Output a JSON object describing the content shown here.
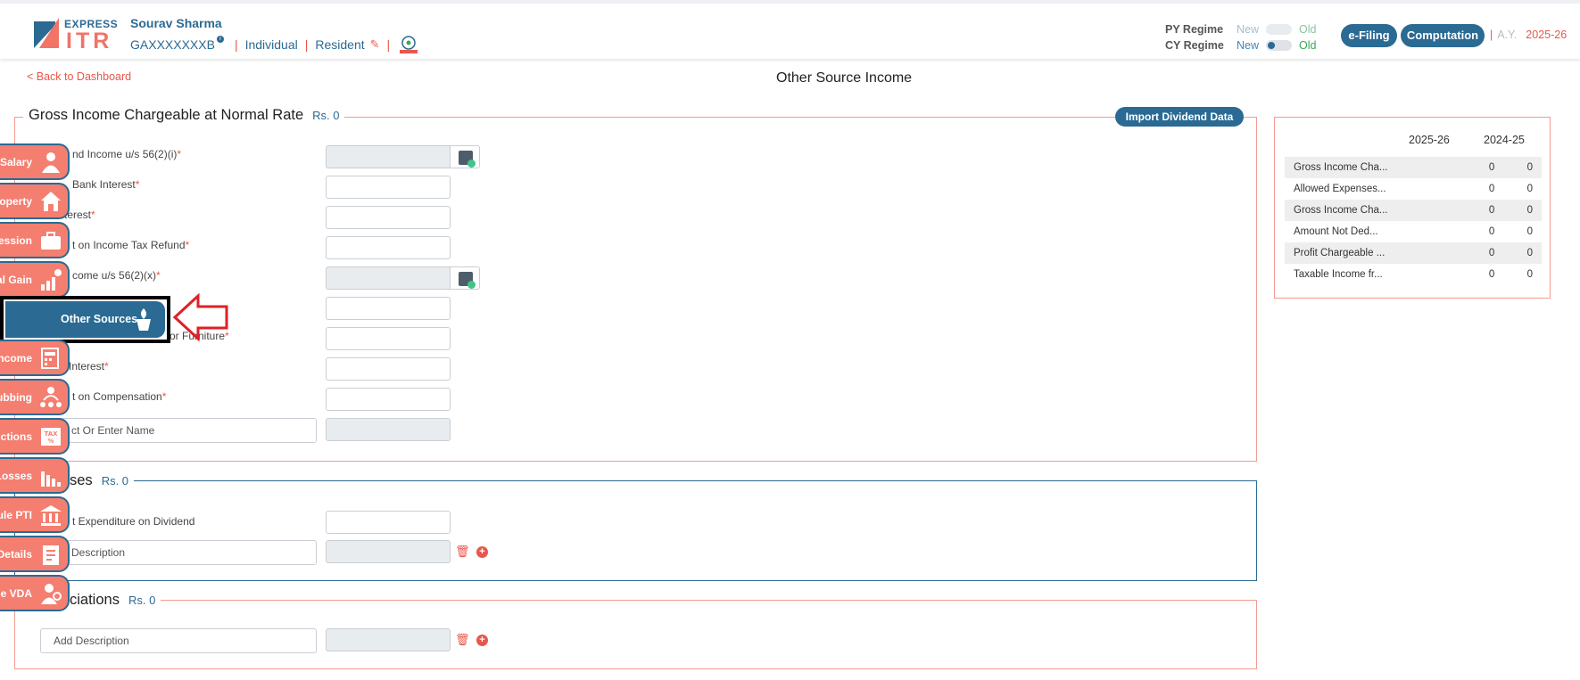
{
  "header": {
    "logo_top": "EXPRESS",
    "logo_bottom": "ITR",
    "user_name": "Sourav Sharma",
    "pan": "GAXXXXXXXB",
    "status": "Individual",
    "residency": "Resident",
    "regime": {
      "py_label": "PY Regime",
      "cy_label": "CY Regime",
      "new_label": "New",
      "old_label": "Old"
    },
    "efiling_label": "e-Filing",
    "computation_label": "Computation",
    "ay_label": "A.Y.",
    "ay_value": "2025-26"
  },
  "page": {
    "back_label": "< Back to Dashboard",
    "title": "Other Source Income"
  },
  "gross_section": {
    "title": "Gross Income Chargeable at Normal Rate",
    "amount": "Rs.  0",
    "import_label": "Import Dividend Data",
    "fields": [
      {
        "label": "nd Income u/s 56(2)(i)",
        "required": "*"
      },
      {
        "label": "Bank Interest",
        "required": "*"
      },
      {
        "label": "terest",
        "required": "*"
      },
      {
        "label": "t on Income Tax Refund",
        "required": "*"
      },
      {
        "label": "come u/s 56(2)(x)",
        "required": "*"
      },
      {
        "label": "",
        "required": ""
      },
      {
        "label": "or Furniture",
        "required": "*"
      },
      {
        "label": "Interest",
        "required": "*"
      },
      {
        "label": "t on Compensation",
        "required": "*"
      }
    ],
    "select_placeholder": "ct Or Enter Name"
  },
  "expenses_section": {
    "title": "ses",
    "amount": "Rs.  0",
    "field_label": "t Expenditure on Dividend",
    "desc_placeholder": "Description"
  },
  "deductions_section": {
    "title": "ciations",
    "amount": "Rs.  0",
    "desc_placeholder": "Add Description"
  },
  "summary": {
    "col1": "2025-26",
    "col2": "2024-25",
    "rows": [
      {
        "label": "Gross Income Cha...",
        "v1": "0",
        "v2": "0"
      },
      {
        "label": "Allowed Expenses...",
        "v1": "0",
        "v2": "0"
      },
      {
        "label": "Gross Income Cha...",
        "v1": "0",
        "v2": "0"
      },
      {
        "label": "Amount Not Ded...",
        "v1": "0",
        "v2": "0"
      },
      {
        "label": "Profit Chargeable ...",
        "v1": "0",
        "v2": "0"
      },
      {
        "label": "Taxable Income fr...",
        "v1": "0",
        "v2": "0"
      }
    ]
  },
  "sidebar": {
    "items": [
      {
        "label": "Salary",
        "icon": "person-icon"
      },
      {
        "label": "operty",
        "icon": "house-icon"
      },
      {
        "label": "fession",
        "icon": "briefcase-icon"
      },
      {
        "label": "al Gain",
        "icon": "growth-chart-icon"
      },
      {
        "label": "Other Sources",
        "icon": "plant-pot-icon"
      },
      {
        "label": "ncome",
        "icon": "tax-calculator-icon"
      },
      {
        "label": "ubbing",
        "icon": "family-tree-icon"
      },
      {
        "label": "uctions",
        "icon": "tax-percent-icon"
      },
      {
        "label": "Losses",
        "icon": "declining-chart-icon"
      },
      {
        "label": "ule PTI",
        "icon": "bank-icon"
      },
      {
        "label": "Details",
        "icon": "tax-clipboard-icon"
      },
      {
        "label": "ule VDA",
        "icon": "person-coin-icon"
      }
    ]
  },
  "colors": {
    "brand_blue": "#2b6a93",
    "accent_red": "#e8574b",
    "nav_salmon": "#f47e70",
    "section_border": "#f39b92"
  }
}
